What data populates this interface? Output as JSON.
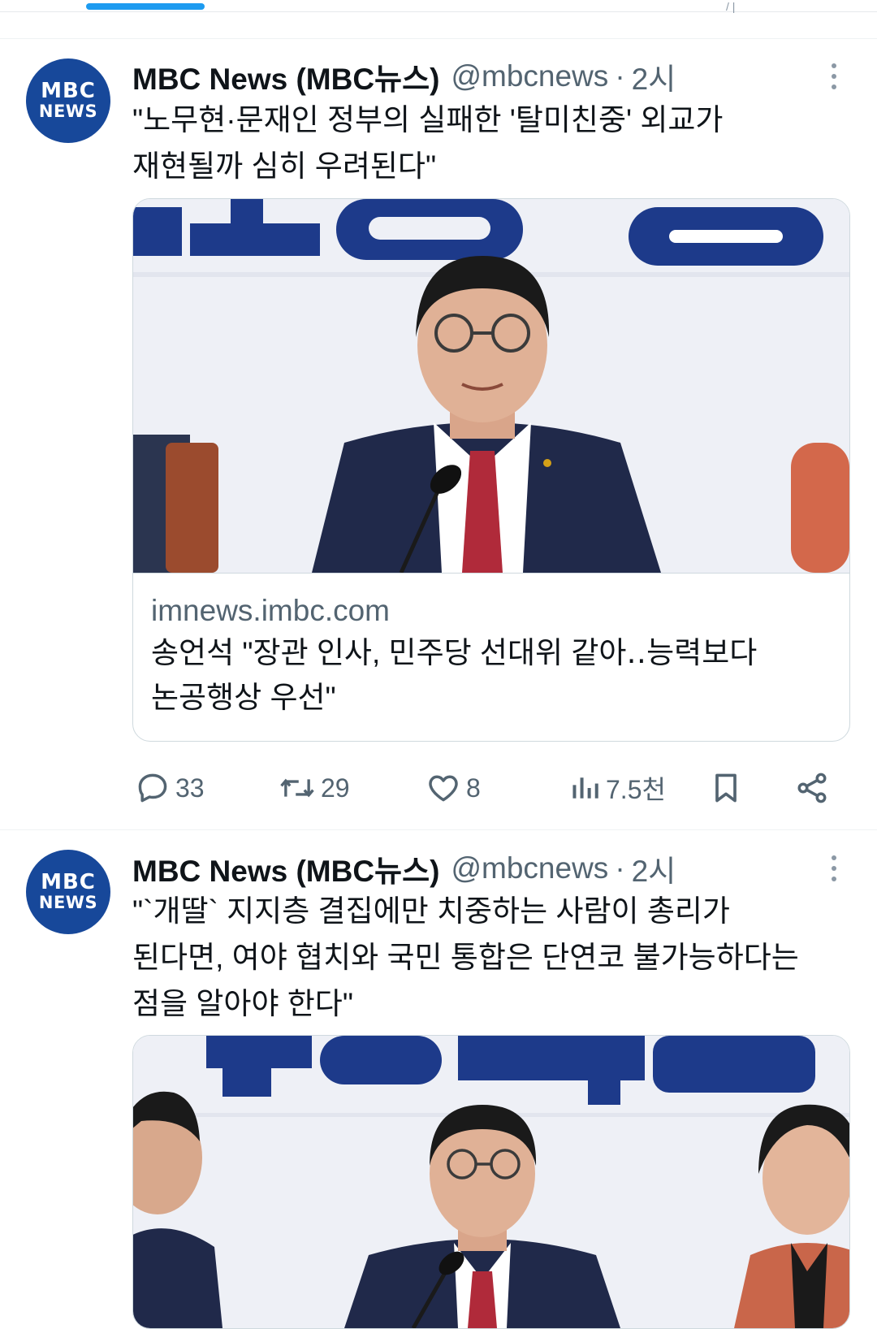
{
  "topbar": {
    "ghost_text": "/ |"
  },
  "tweets": [
    {
      "author_name": "MBC News (MBC뉴스)",
      "handle": "@mbcnews",
      "separator": "·",
      "time": "2시",
      "avatar": {
        "line1": "MBC",
        "line2": "NEWS",
        "bg_color": "#17489a"
      },
      "text_lines": [
        "\"노무현·문재인 정부의 실패한 '탈미친중' 외교가",
        "재현될까 심히 우려된다\""
      ],
      "card": {
        "image_icon": "photo-politician-at-microphone",
        "domain": "imnews.imbc.com",
        "title_lines": [
          "송언석 \"장관 인사, 민주당 선대위 같아‥능력보다",
          "논공행상 우선\""
        ]
      },
      "actions": {
        "reply": "33",
        "retweet": "29",
        "like": "8",
        "views": "7.5천"
      }
    },
    {
      "author_name": "MBC News (MBC뉴스)",
      "handle": "@mbcnews",
      "separator": "·",
      "time": "2시",
      "avatar": {
        "line1": "MBC",
        "line2": "NEWS",
        "bg_color": "#17489a"
      },
      "text_lines": [
        "\"`개딸` 지지층 결집에만 치중하는 사람이 총리가",
        "된다면, 여야 협치와 국민 통합은 단연코 불가능하다는",
        "점을 알아야 한다\""
      ],
      "card": {
        "image_icon": "photo-party-meeting"
      }
    }
  ],
  "colors": {
    "accent": "#1d9bf0",
    "text_primary": "#0f1419",
    "text_secondary": "#536471",
    "border": "#cfd9de",
    "mbc_blue": "#17489a"
  }
}
